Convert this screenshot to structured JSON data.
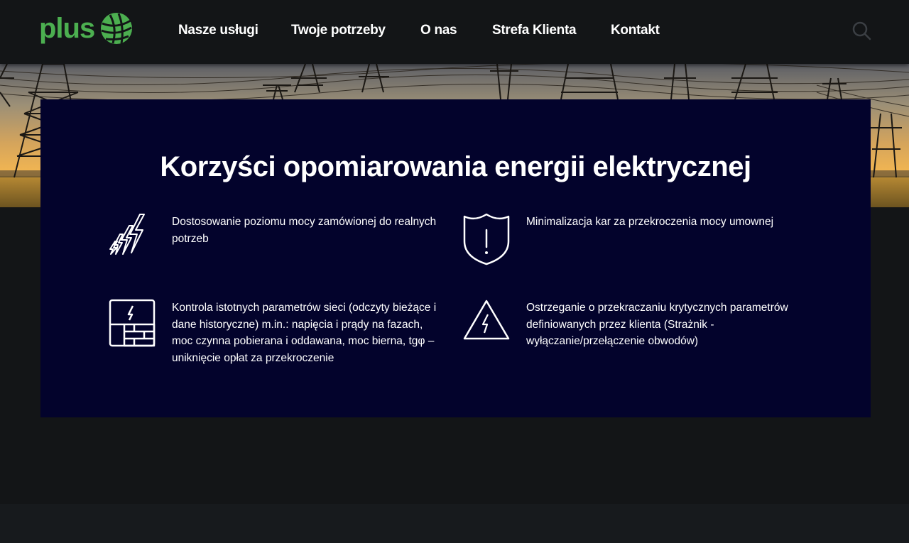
{
  "header": {
    "logo_text": "plus",
    "nav": [
      {
        "label": "Nasze usługi"
      },
      {
        "label": "Twoje potrzeby"
      },
      {
        "label": "O nas"
      },
      {
        "label": "Strefa Klienta"
      },
      {
        "label": "Kontakt"
      }
    ],
    "search_icon": "search-icon"
  },
  "colors": {
    "brand_green": "#4caf50",
    "header_bg": "#131517",
    "panel_bg": "#03032c",
    "text": "#ffffff"
  },
  "panel": {
    "title": "Korzyści opomiarowania energii elektrycznej",
    "benefits": [
      {
        "icon": "lightning-bolts-icon",
        "text": "Dostosowanie poziomu mocy zamówionej do realnych potrzeb"
      },
      {
        "icon": "shield-exclamation-icon",
        "text": "Minimalizacja kar za przekroczenia mocy umownej"
      },
      {
        "icon": "electrical-panel-icon",
        "text": "Kontrola istotnych parametrów sieci (odczyty bieżące i dane historyczne) m.in.: napięcia i prądy na fazach, moc czynna pobierana i oddawana, moc bierna, tgφ – uniknięcie opłat za przekroczenie"
      },
      {
        "icon": "warning-triangle-icon",
        "text": "Ostrzeganie o przekraczaniu krytycznych parametrów definiowanych przez klienta (Strażnik - wyłączanie/przełączenie obwodów)"
      }
    ]
  }
}
